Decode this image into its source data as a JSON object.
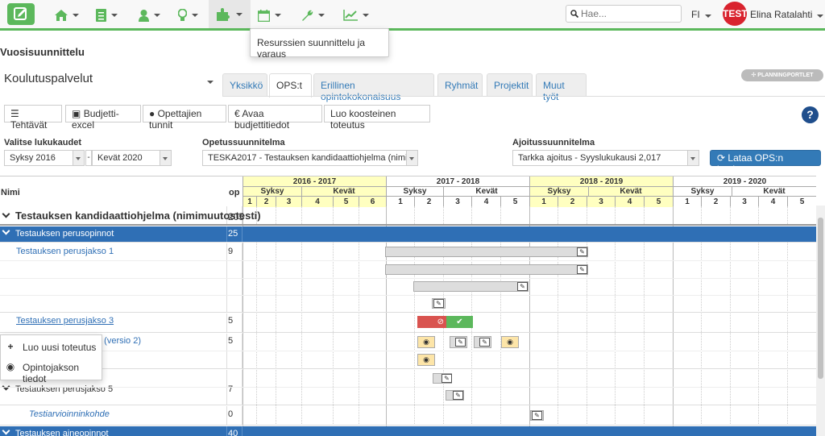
{
  "nav": {
    "search_placeholder": "Hae...",
    "lang": "FI",
    "avatar_text": "TEST",
    "user_name": "Elina Ratalahti",
    "tooltip": "Resurssien suunnittelu ja varaus"
  },
  "page": {
    "title": "Vuosisuunnittelu",
    "org": "Koulutuspalvelut",
    "planning_button": "PLANNINGPORTLET"
  },
  "tabs": [
    "Yksikkö",
    "OPS:t",
    "Erillinen opintokokonaisuus",
    "Ryhmät",
    "Projektit",
    "Muut työt"
  ],
  "toolbar": {
    "tehtavat": "Tehtävät",
    "budjetti": "Budjetti-excel",
    "opettajien": "Opettajien tunnit",
    "avaa": "Avaa budjettitiedot",
    "luo": "Luo koosteinen toteutus",
    "help": "?"
  },
  "filters": {
    "lukukaudet_label": "Valitse lukukaudet",
    "from": "Syksy 2016",
    "to": "Kevät 2020",
    "dash": "-",
    "ops_label": "Opetussuunnitelma",
    "ops_value": "TESKA2017 - Testauksen kandidaattiohjelma (nimi...",
    "ajoitus_label": "Ajoitussuunnitelma",
    "ajoitus_value": "Tarkka ajoitus - Syyslukukausi 2,017",
    "load_button": "Lataa OPS:n koulutus"
  },
  "grid": {
    "col_name": "Nimi",
    "col_op": "op",
    "years": [
      "2016 - 2017",
      "2017 - 2018",
      "2018 - 2019",
      "2019 - 2020"
    ],
    "sem_autumn": "Syksy",
    "sem_spring": "Kevät",
    "periods_y1": [
      "1",
      "2",
      "3",
      "4",
      "5",
      "6"
    ],
    "periods": [
      "1",
      "2",
      "3",
      "4",
      "5"
    ],
    "rows": {
      "program": "Testauksen kandidaattiohjelma (nimimuutostesti)",
      "program_op": "205",
      "perus": "Testauksen perusopinnot",
      "perus_op": "25",
      "pj1": "Testauksen perusjakso 1",
      "pj1_op": "9",
      "pj3": "Testauksen perusjakso 3",
      "pj3_op": "5",
      "pj4": "4 (versio 2)",
      "pj4_op": "5",
      "pj5": "Testauksen perusjakso 5",
      "pj5_op": "7",
      "arvio": "Testiarvioinninkohde",
      "arvio_op": "0",
      "aine": "Testauksen aineopinnot",
      "aine_op": "40"
    }
  },
  "context_menu": {
    "new": "Luo uusi toteutus",
    "info": "Opintojakson tiedot"
  },
  "colors": {
    "brand_green": "#5cb85c",
    "row_blue": "#2f6fb5",
    "header_yellow": "#ffffc0",
    "status_red": "#d9534f",
    "status_green": "#5cb85c",
    "highlight_orange": "#fde5a8"
  }
}
